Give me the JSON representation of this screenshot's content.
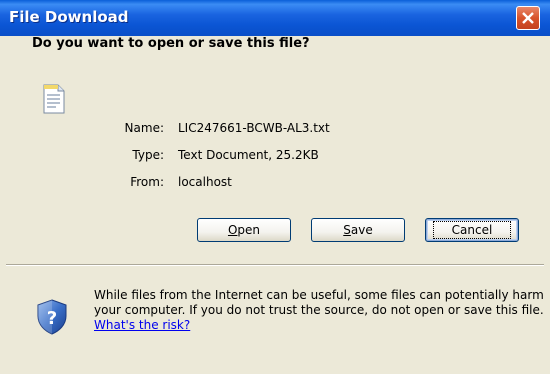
{
  "window": {
    "title": "File Download"
  },
  "dialog": {
    "question": "Do you want to open or save this file?",
    "fields": [
      {
        "label": "Name:",
        "value": "LIC247661-BCWB-AL3.txt"
      },
      {
        "label": "Type:",
        "value": "Text Document, 25.2KB"
      },
      {
        "label": "From:",
        "value": "localhost"
      }
    ],
    "buttons": {
      "open": {
        "mnemonic": "O",
        "rest": "pen"
      },
      "save": {
        "mnemonic": "S",
        "rest": "ave"
      },
      "cancel": "Cancel"
    },
    "warning": {
      "text": "While files from the Internet can be useful, some files can potentially harm your computer. If you do not trust the source, do not open or save this file.",
      "link": "What's the risk?"
    }
  },
  "icons": {
    "file": "text-file-icon",
    "shield": "security-shield-icon",
    "close": "close-icon"
  },
  "colors": {
    "titlebar": "#0b55d4",
    "close": "#d8532b",
    "dialog_bg": "#ece9d8",
    "link": "#0000ee"
  }
}
